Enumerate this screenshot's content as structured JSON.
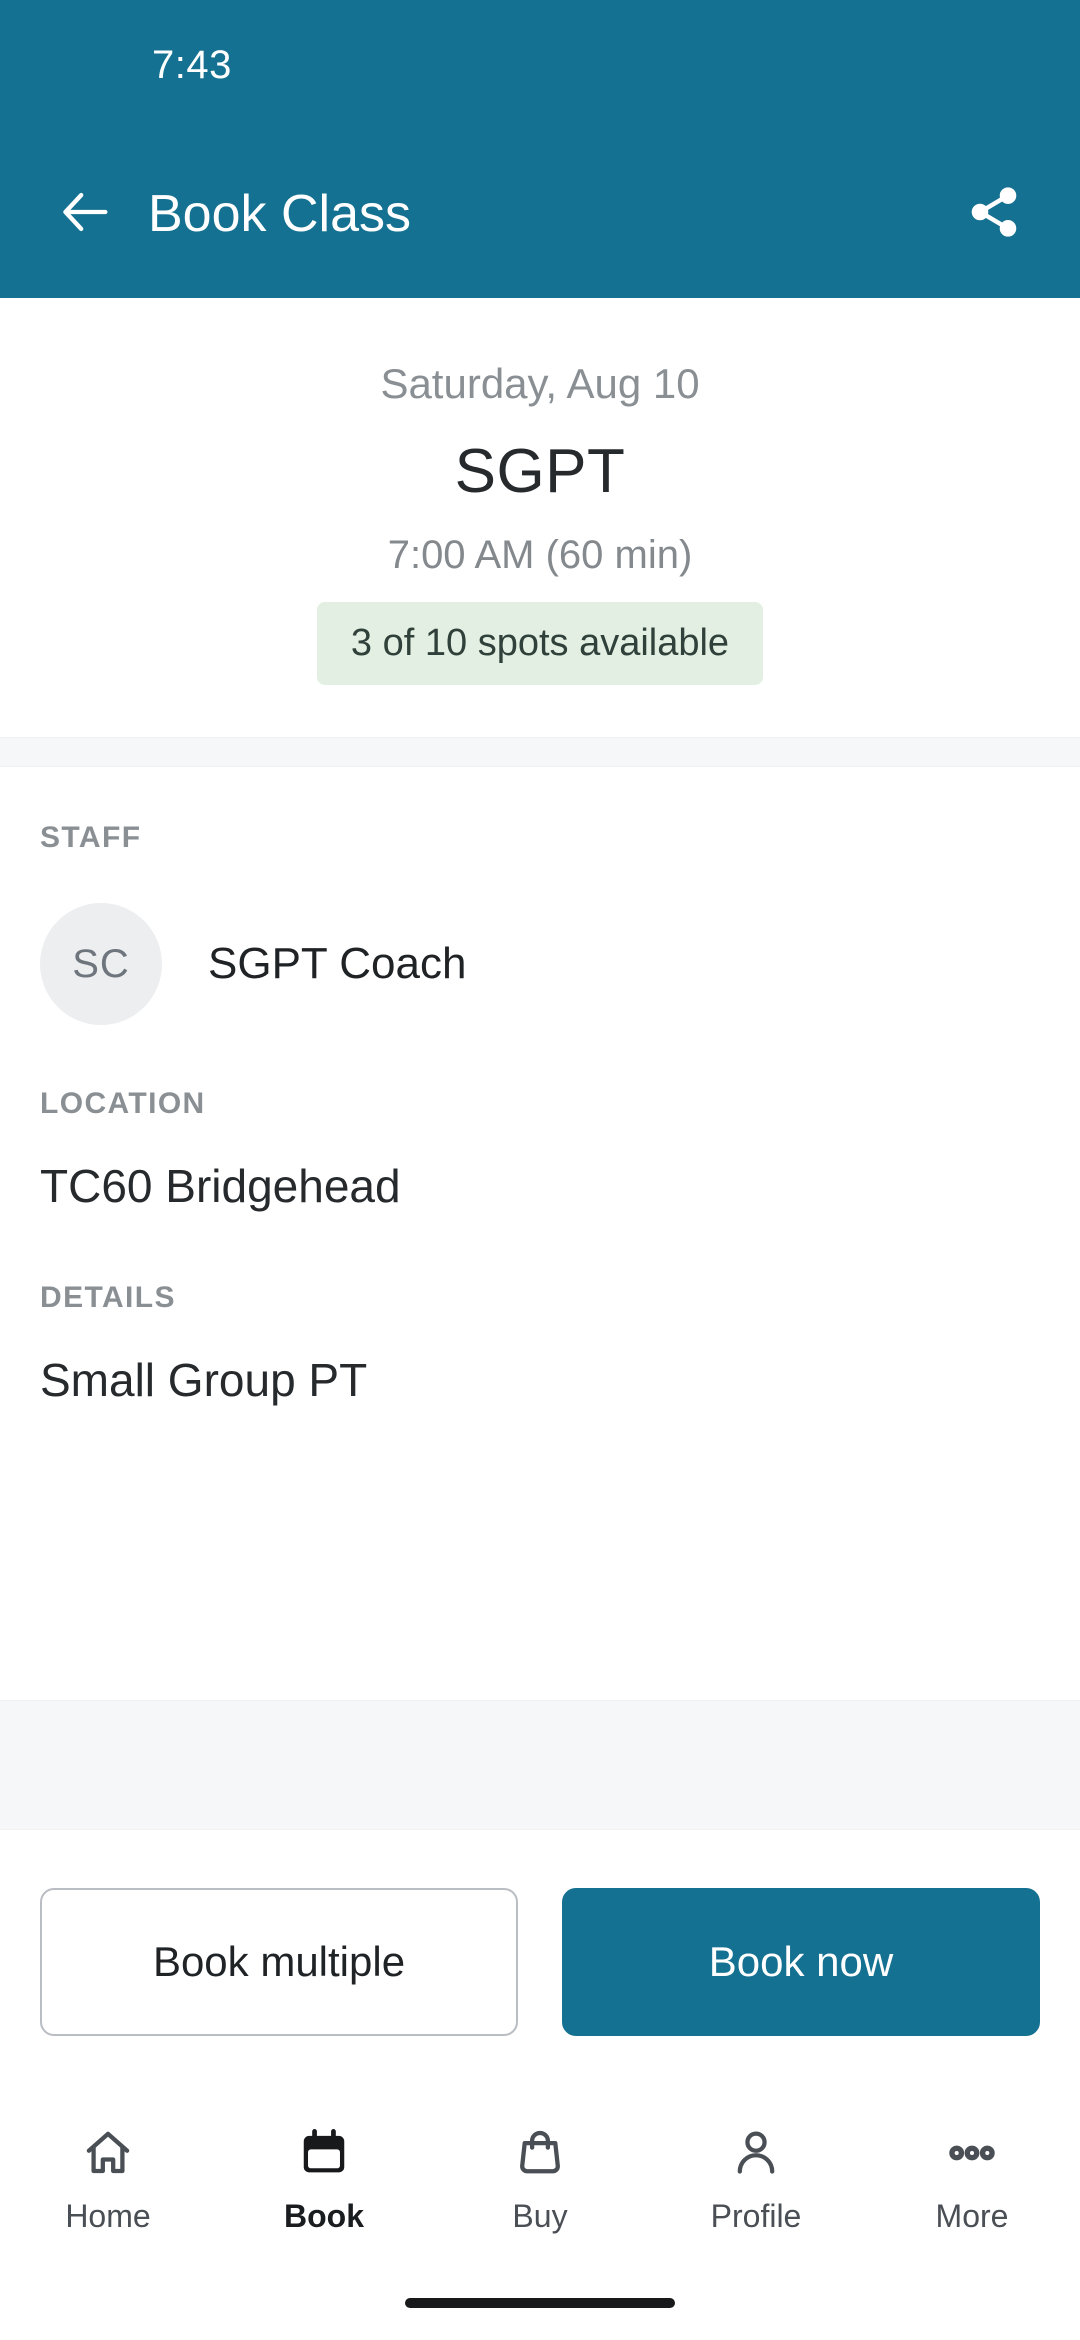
{
  "status_bar": {
    "time": "7:43"
  },
  "app_bar": {
    "title": "Book Class",
    "back_icon": "arrow-left-icon",
    "share_icon": "share-icon"
  },
  "class_summary": {
    "date": "Saturday, Aug 10",
    "name": "SGPT",
    "time": "7:00 AM (60 min)",
    "spots_badge": "3 of 10 spots available",
    "spots_available": 3,
    "spots_total": 10
  },
  "sections": {
    "staff": {
      "label": "STAFF",
      "avatar_initials": "SC",
      "name": "SGPT Coach"
    },
    "location": {
      "label": "LOCATION",
      "value": "TC60 Bridgehead"
    },
    "details": {
      "label": "DETAILS",
      "value": "Small Group PT"
    }
  },
  "actions": {
    "secondary_label": "Book multiple",
    "primary_label": "Book now"
  },
  "bottom_nav": {
    "items": [
      {
        "label": "Home",
        "icon": "home-icon",
        "active": false
      },
      {
        "label": "Book",
        "icon": "calendar-icon",
        "active": true
      },
      {
        "label": "Buy",
        "icon": "shopping-bag-icon",
        "active": false
      },
      {
        "label": "Profile",
        "icon": "person-icon",
        "active": false
      },
      {
        "label": "More",
        "icon": "more-dots-icon",
        "active": false
      }
    ]
  },
  "colors": {
    "brand_teal": "#157191",
    "badge_green_bg": "#e3efe2",
    "badge_green_text": "#30403a",
    "section_bg_gray": "#f6f7f9",
    "muted_text": "#8a8f94"
  }
}
